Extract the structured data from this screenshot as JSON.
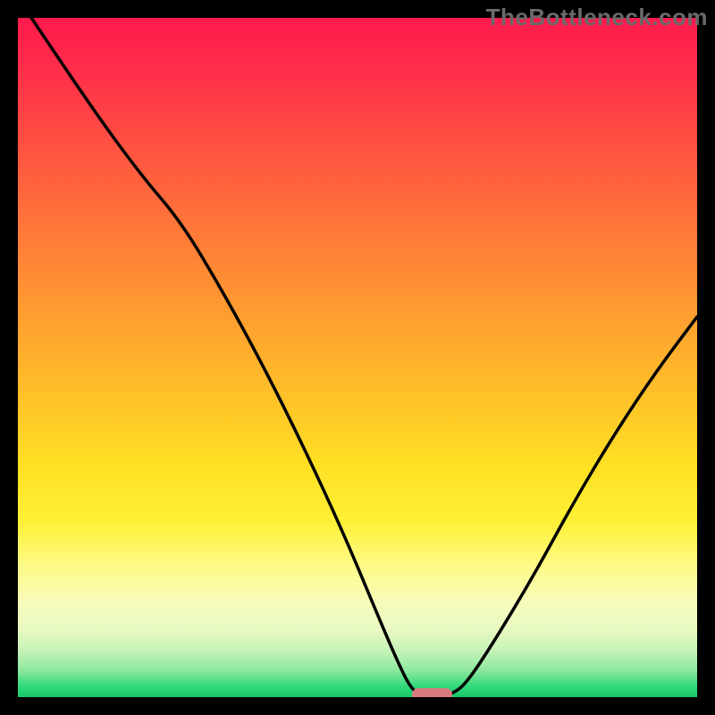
{
  "watermark": "TheBottleneck.com",
  "colors": {
    "frame_bg": "#000000",
    "watermark_text": "#6a6a6a",
    "curve": "#000000",
    "marker": "#d97b7e",
    "gradient_top": "#ff1a4d",
    "gradient_bottom": "#17c968"
  },
  "chart_data": {
    "type": "line",
    "title": "",
    "xlabel": "",
    "ylabel": "",
    "xlim": [
      0,
      100
    ],
    "ylim": [
      0,
      100
    ],
    "grid": false,
    "legend": false,
    "series": [
      {
        "name": "bottleneck-curve",
        "x": [
          2,
          10,
          18,
          24,
          30,
          36,
          42,
          48,
          53,
          56,
          58,
          60,
          62,
          64,
          66,
          70,
          76,
          82,
          88,
          94,
          100
        ],
        "y": [
          100,
          88,
          77,
          70,
          60,
          49,
          37,
          24,
          12,
          5,
          1,
          0,
          0,
          0.5,
          2,
          8,
          18,
          29,
          39,
          48,
          56
        ]
      }
    ],
    "marker": {
      "x_start": 58,
      "x_end": 64,
      "y": 0
    },
    "annotations": []
  }
}
